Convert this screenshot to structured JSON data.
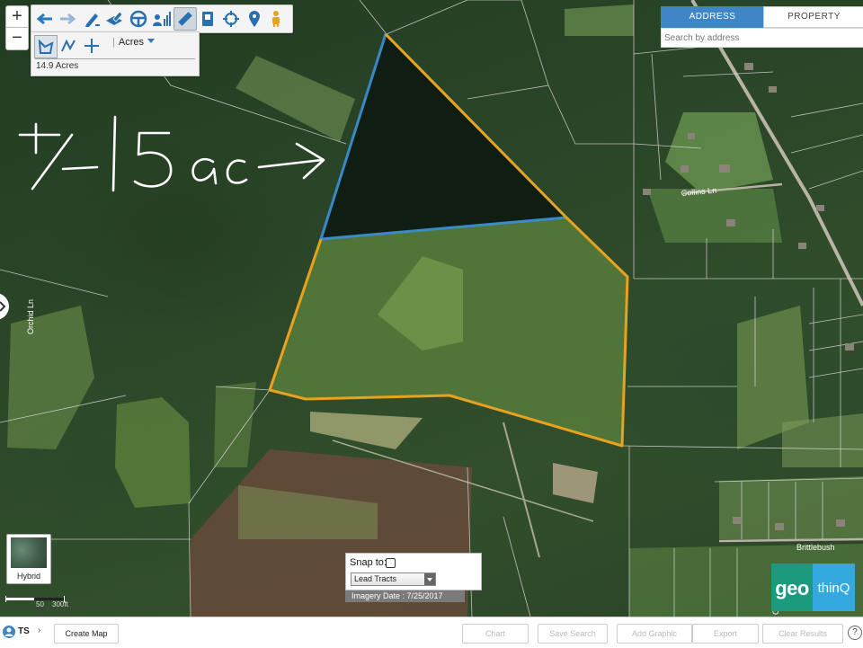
{
  "toolbar": {
    "tools": [
      "arrow-left-icon",
      "arrow-right-icon",
      "pen-icon",
      "layers-pen-icon",
      "steering-wheel-icon",
      "people-chart-icon",
      "ruler-icon",
      "phone-book-icon",
      "crosshair-icon",
      "map-pin-icon",
      "pegman-icon"
    ],
    "zoom_in": "+",
    "zoom_out": "−"
  },
  "measure": {
    "units": "Acres",
    "result": "14.9 Acres"
  },
  "search": {
    "tab_address": "ADDRESS",
    "tab_property": "PROPERTY",
    "placeholder": "Search by address"
  },
  "map": {
    "road_labels": [
      "Orchid Ln",
      "Collins Ln",
      "Brittlebush",
      "Orch"
    ],
    "handwritten_annotation": "+/- 15 ac →",
    "colors": {
      "parcel_outline": "#e8a21f",
      "selection_outline": "#3a8fd6",
      "selection_fill": "#0e1a12",
      "parcel_lines": "#d8d8d8"
    }
  },
  "basemap": {
    "label": "Hybrid"
  },
  "scale": {
    "labels": [
      "50",
      "300ft"
    ]
  },
  "snap": {
    "label": "Snap to:",
    "layer": "Lead Tracts",
    "imagery_date": "Imagery Date : 7/25/2017"
  },
  "logo": {
    "geo": "geo",
    "thinq": "thinQ"
  },
  "bottombar": {
    "user_initials": "TS",
    "user_caret": "›",
    "create_map": "Create Map",
    "chart": "Chart",
    "save_search": "Save Search",
    "add_graphic": "Add Graphic",
    "export": "Export",
    "clear_results": "Clear Results",
    "help": "?"
  }
}
